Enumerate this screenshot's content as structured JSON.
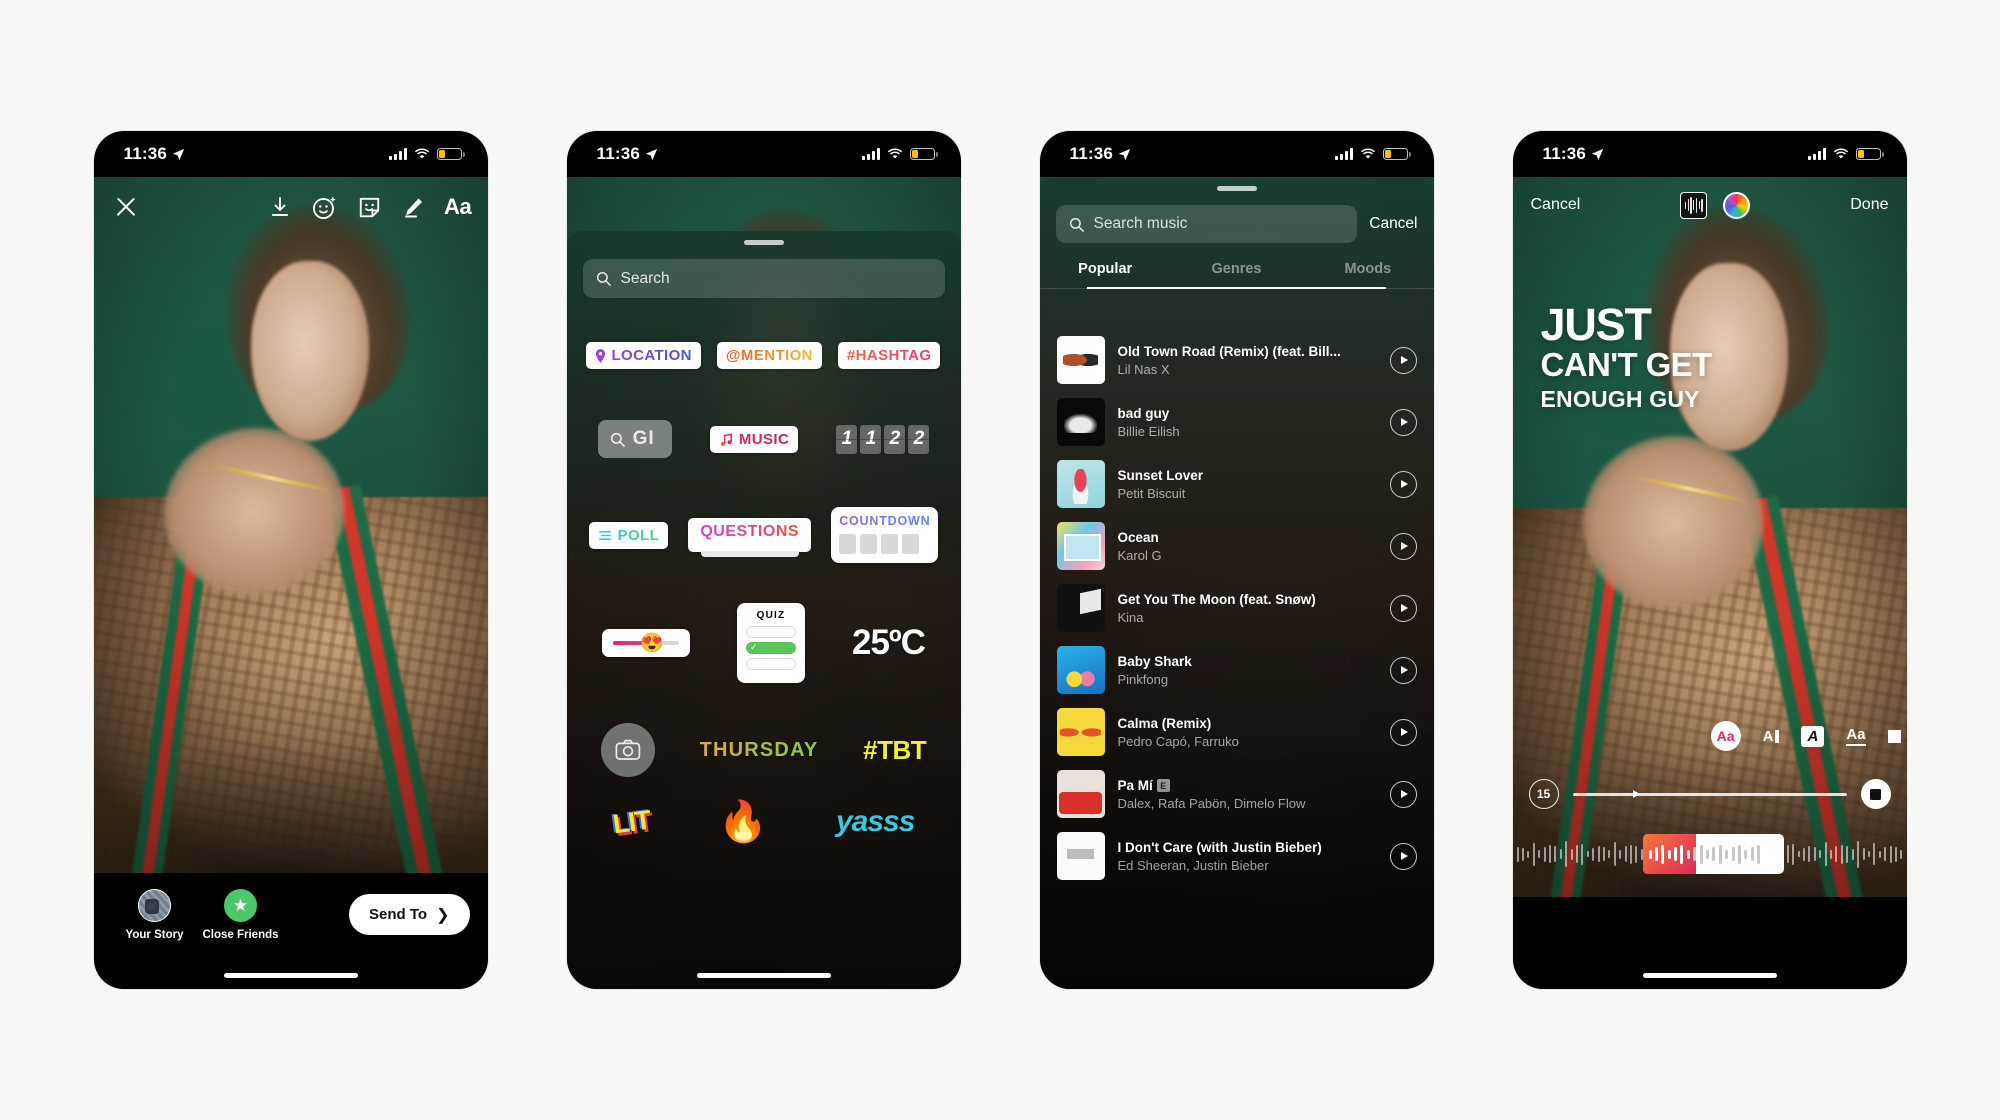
{
  "status_bar": {
    "time": "11:36",
    "location_icon": "location-arrow-icon",
    "signal_icon": "cellular-bars-icon",
    "wifi_icon": "wifi-icon",
    "battery_icon": "battery-low-icon"
  },
  "phone1": {
    "name": "story-editor",
    "toolbar": {
      "close_label": "close-icon",
      "items": [
        {
          "icon": "download-icon",
          "label": "Save"
        },
        {
          "icon": "sparkle-face-icon",
          "label": "Effects"
        },
        {
          "icon": "sticker-face-icon",
          "label": "Stickers"
        },
        {
          "icon": "pen-icon",
          "label": "Draw"
        },
        {
          "icon": "text-aa-icon",
          "label": "Aa"
        }
      ]
    },
    "bottom": {
      "your_story_label": "Your Story",
      "close_friends_label": "Close Friends",
      "close_friends_icon": "star-icon",
      "send_to_label": "Send To",
      "send_to_chevron": "chevron-right-icon"
    }
  },
  "phone2": {
    "name": "sticker-tray",
    "search_placeholder": "Search",
    "search_icon": "search-icon",
    "rows": [
      [
        {
          "id": "location",
          "label": "LOCATION",
          "icon": "pin-icon",
          "style": "g-loc"
        },
        {
          "id": "mention",
          "label": "@MENTION",
          "style": "g-men"
        },
        {
          "id": "hashtag",
          "label": "#HASHTAG",
          "style": "g-tag"
        }
      ],
      [
        {
          "id": "gif",
          "label": "GI",
          "icon": "search-icon"
        },
        {
          "id": "music",
          "label": "MUSIC",
          "icon": "music-note-icon",
          "style": "g-mus"
        },
        {
          "id": "countdown-clock",
          "digits": [
            "1",
            "1",
            "2",
            "2"
          ]
        }
      ],
      [
        {
          "id": "poll",
          "label": "POLL",
          "icon": "poll-lines-icon",
          "style": "g-poll"
        },
        {
          "id": "questions",
          "label": "QUESTIONS",
          "style": "g-ques"
        },
        {
          "id": "countdown",
          "label": "COUNTDOWN",
          "style": "g-cd",
          "cells": 4
        }
      ],
      [
        {
          "id": "slider",
          "emoji": "😍"
        },
        {
          "id": "quiz",
          "label": "QUIZ",
          "options": 3,
          "correct_index": 1
        },
        {
          "id": "temperature",
          "label": "25ºC"
        }
      ],
      [
        {
          "id": "camera",
          "icon": "camera-icon"
        },
        {
          "id": "weekday",
          "label": "THURSDAY"
        },
        {
          "id": "tbt",
          "label": "#TBT"
        }
      ],
      [
        {
          "id": "gif-lit",
          "label": "LIT"
        },
        {
          "id": "gif-fire",
          "label": "🔥"
        },
        {
          "id": "gif-yass",
          "label": "yasss"
        }
      ]
    ]
  },
  "phone3": {
    "name": "music-picker",
    "search_placeholder": "Search music",
    "search_icon": "search-icon",
    "cancel_label": "Cancel",
    "tabs": [
      {
        "label": "Popular",
        "active": true
      },
      {
        "label": "Genres",
        "active": false
      },
      {
        "label": "Moods",
        "active": false
      }
    ],
    "tracks": [
      {
        "title": "Old Town Road (Remix) (feat. Bill...",
        "artist": "Lil Nas X",
        "art": "c-otr",
        "explicit": false
      },
      {
        "title": "bad guy",
        "artist": "Billie Eilish",
        "art": "c-bg",
        "explicit": false
      },
      {
        "title": "Sunset Lover",
        "artist": "Petit Biscuit",
        "art": "c-sl",
        "explicit": false
      },
      {
        "title": "Ocean",
        "artist": "Karol G",
        "art": "c-oc",
        "explicit": false
      },
      {
        "title": "Get You The Moon (feat. Snøw)",
        "artist": "Kina",
        "art": "c-gy",
        "explicit": false
      },
      {
        "title": "Baby Shark",
        "artist": "Pinkfong",
        "art": "c-bs",
        "explicit": false
      },
      {
        "title": "Calma (Remix)",
        "artist": "Pedro Capó, Farruko",
        "art": "c-ca",
        "explicit": false
      },
      {
        "title": "Pa Mí",
        "artist": "Dalex, Rafa Pabön, Dimelo Flow",
        "art": "c-pm",
        "explicit": true
      },
      {
        "title": "I Don't Care (with Justin Bieber)",
        "artist": "Ed Sheeran, Justin Bieber",
        "art": "c-id",
        "explicit": false
      }
    ],
    "explicit_badge": "E",
    "play_icon": "play-icon"
  },
  "phone4": {
    "name": "lyrics-text-editor",
    "cancel_label": "Cancel",
    "done_label": "Done",
    "waveform_icon": "waveform-thumbnail-icon",
    "color_icon": "color-wheel-icon",
    "lyrics": {
      "line1": "JUST",
      "line2": "CAN'T GET",
      "line3": "ENOUGH GUY"
    },
    "font_options": [
      {
        "id": "font-classic",
        "label": "Aa",
        "selected": true
      },
      {
        "id": "font-modern",
        "label": "A"
      },
      {
        "id": "font-neon",
        "label": "A"
      },
      {
        "id": "font-typewriter",
        "label": "Aa"
      },
      {
        "id": "font-strong",
        "label": ""
      }
    ],
    "duration_label": "15",
    "stop_icon": "stop-icon",
    "play_head_icon": "play-icon"
  }
}
